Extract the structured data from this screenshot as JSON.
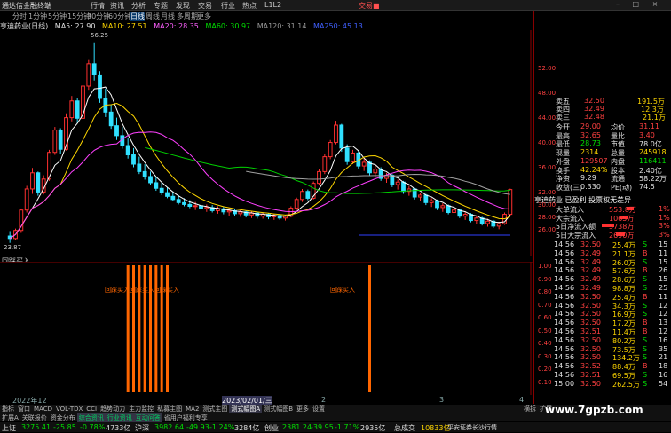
{
  "menu": {
    "logo": "通达信金融终端",
    "items": [
      "行情",
      "资讯",
      "分析",
      "专题",
      "发现",
      "交易",
      "行业",
      "热点",
      "L1L2"
    ],
    "trade": "交易■",
    "window_buttons": "– □ ×"
  },
  "periods": [
    "分时",
    "1分钟",
    "5分钟",
    "15分钟",
    "30分钟",
    "60分钟",
    "日线",
    "周线",
    "月线",
    "多周期",
    "更多"
  ],
  "active_period": "日线",
  "ma_line": {
    "stock": "亨迪药业(日线)",
    "ma5": "MA5: 27.90",
    "ma10": "MA10: 27.51",
    "ma20": "MA20: 28.35",
    "ma60": "MA60: 30.97",
    "ma120": "MA120: 31.14",
    "ma250": "MA250: 45.13"
  },
  "price_labels": {
    "high": "56.25",
    "low": "23.87"
  },
  "axis_ticks": [
    "52.00",
    "48.00",
    "44.00",
    "40.00",
    "36.00",
    "32.00",
    "30.00",
    "28.00",
    "26.00"
  ],
  "indicator": {
    "label": "回踩买入",
    "signal_texts": [
      "回踩买入回踩买入回踩买入",
      "回踩买入"
    ]
  },
  "sub_axis": [
    "1.00",
    "0.90",
    "0.80",
    "0.70",
    "0.60",
    "0.50",
    "0.40",
    "0.30",
    "0.20",
    "0.10"
  ],
  "dates": {
    "left": "2022年12",
    "mid": "2023/02/01/三",
    "m2": "2",
    "m3": "3",
    "m4": "4"
  },
  "tabs1": [
    "指标",
    "窗口",
    "MACD",
    "VOL-TDX",
    "CCI",
    "趋势动力",
    "主力监控",
    "私募主图",
    "MA2",
    "测式主图",
    "测式幅图A",
    "测式幅图B",
    "更多",
    "设置"
  ],
  "tabs1_selected": "测式幅图A",
  "tabs2": [
    "扩展A",
    "关联报价",
    "资金分布",
    "综合资讯",
    "行业资讯",
    "互动问答",
    "省用户福利专享"
  ],
  "tabs_right": [
    "横拆",
    "扩展"
  ],
  "quote": {
    "sell5": [
      "卖五",
      "32.50",
      "191.5万"
    ],
    "sell4": [
      "卖四",
      "32.49",
      "12.3万"
    ],
    "sell3": [
      "卖三",
      "32.48",
      "21.1万"
    ],
    "rows": [
      [
        "今开",
        "29.00",
        "均价",
        "31.11"
      ],
      [
        "最高",
        "32.65",
        "量比",
        "3.40"
      ],
      [
        "最低",
        "28.73",
        "市值",
        "78.0亿"
      ],
      [
        "现量",
        "2314",
        "总量",
        "245918"
      ],
      [
        "外盘",
        "129507",
        "内盘",
        "116411"
      ],
      [
        "换手",
        "42.24%",
        "股本",
        "2.40亿"
      ],
      [
        "净资",
        "9.29",
        "流通",
        "58.22万"
      ],
      [
        "收益(三)",
        "0.330",
        "PE(动)",
        "74.5"
      ]
    ],
    "company": "亨迪药业 已盈利 投票权无差异",
    "flows": [
      [
        "大单流入",
        "553.8万",
        "1%"
      ],
      [
        "大宗流入",
        "1065万",
        "1%"
      ],
      [
        "5日净流入额",
        "5738万",
        "3%"
      ],
      [
        "5日大宗流入",
        "2690万",
        "3%"
      ]
    ],
    "ticks": [
      [
        "14:56",
        "32.50",
        "25.4万",
        "S",
        "15"
      ],
      [
        "14:56",
        "32.49",
        "21.1万",
        "B",
        "11"
      ],
      [
        "14:56",
        "32.49",
        "26.0万",
        "S",
        "15"
      ],
      [
        "14:56",
        "32.49",
        "57.6万",
        "B",
        "26"
      ],
      [
        "14:56",
        "32.49",
        "28.6万",
        "S",
        "15"
      ],
      [
        "14:56",
        "32.49",
        "98.8万",
        "S",
        "25"
      ],
      [
        "14:56",
        "32.50",
        "25.4万",
        "B",
        "11"
      ],
      [
        "14:56",
        "32.50",
        "34.3万",
        "S",
        "12"
      ],
      [
        "14:56",
        "32.50",
        "16.9万",
        "S",
        "12"
      ],
      [
        "14:56",
        "32.50",
        "17.2万",
        "B",
        "13"
      ],
      [
        "14:56",
        "32.51",
        "11.4万",
        "B",
        "12"
      ],
      [
        "14:56",
        "32.50",
        "80.2万",
        "S",
        "16"
      ],
      [
        "14:56",
        "32.50",
        "73.5万",
        "S",
        "35"
      ],
      [
        "14:56",
        "32.50",
        "134.2万",
        "S",
        "21"
      ],
      [
        "14:56",
        "32.52",
        "88.4万",
        "B",
        "18"
      ],
      [
        "14:56",
        "32.51",
        "69.5万",
        "S",
        "16"
      ],
      [
        "15:00",
        "32.50",
        "262.5万",
        "S",
        "54"
      ]
    ]
  },
  "status": {
    "sh": [
      "上证",
      "3275.41",
      "-25.85",
      "-0.78%",
      "4733亿"
    ],
    "hs": [
      "沪深",
      "3982.64",
      "-49.93",
      "-1.24%",
      "3284亿"
    ],
    "cy": [
      "创业",
      "2381.24",
      "-39.95",
      "-1.71%",
      "2935亿"
    ],
    "misc": [
      "总成交",
      "10833亿",
      "平安证券长沙行情"
    ]
  },
  "watermark": "www.7gpzb.com",
  "colors": {
    "up": "#ff3030",
    "down": "#30e0ff",
    "ma5": "#ffffff",
    "ma10": "#ffd700",
    "ma20": "#ff40ff",
    "ma60": "#00d000",
    "ma120": "#a0a0a0",
    "signal": "#ff6600"
  },
  "chart_data": {
    "type": "candlestick",
    "y_range": [
      23,
      56.5
    ],
    "candles": [
      [
        25,
        25.8,
        23.9,
        24.6
      ],
      [
        24.6,
        26.2,
        24.3,
        25.9
      ],
      [
        25.9,
        29.4,
        25.5,
        29.2
      ],
      [
        29.2,
        33.1,
        28.8,
        32.6
      ],
      [
        32.6,
        36,
        31.8,
        35.2
      ],
      [
        35.2,
        35.4,
        31.5,
        32.1
      ],
      [
        32.1,
        34.8,
        31.7,
        34.2
      ],
      [
        34.2,
        38.9,
        33.9,
        38.5
      ],
      [
        38.5,
        42.6,
        38.1,
        42.1
      ],
      [
        42.1,
        42.4,
        38.2,
        39
      ],
      [
        39,
        44.8,
        38.8,
        44.1
      ],
      [
        44.1,
        47.6,
        43.5,
        46.8
      ],
      [
        46.8,
        47.2,
        43.2,
        44
      ],
      [
        44,
        49.8,
        43.6,
        49.2
      ],
      [
        49.2,
        53.4,
        48.6,
        52.8
      ],
      [
        52.8,
        56.25,
        50.1,
        51
      ],
      [
        51,
        51.6,
        46.5,
        47.2
      ],
      [
        47.2,
        48.8,
        44.2,
        45
      ],
      [
        45,
        46.2,
        42.3,
        42.8
      ],
      [
        42.8,
        44.1,
        40.5,
        41.2
      ],
      [
        41.2,
        42.6,
        39.1,
        39.6
      ],
      [
        39.6,
        40.9,
        37.5,
        38.1
      ],
      [
        38.1,
        39.2,
        36.1,
        36.6
      ],
      [
        36.6,
        37.8,
        35,
        35.4
      ],
      [
        35.4,
        36.6,
        34.1,
        34.6
      ],
      [
        34.6,
        35.4,
        33.2,
        33.6
      ],
      [
        33.6,
        34.5,
        32.3,
        32.7
      ],
      [
        32.7,
        33.6,
        31.6,
        32
      ],
      [
        32,
        32.9,
        31.1,
        31.4
      ],
      [
        31.4,
        32.2,
        30.6,
        30.9
      ],
      [
        30.9,
        31.6,
        30.1,
        30.4
      ],
      [
        30.4,
        31.1,
        29.8,
        30.1
      ],
      [
        30.1,
        30.8,
        29.5,
        29.8
      ],
      [
        29.8,
        30.5,
        29.2,
        29.9
      ],
      [
        29.9,
        30.3,
        29.1,
        29.4
      ],
      [
        29.4,
        30.1,
        28.9,
        29.6
      ],
      [
        29.6,
        30,
        28.8,
        29.1
      ],
      [
        29.1,
        29.8,
        28.6,
        29.4
      ],
      [
        29.4,
        29.7,
        28.5,
        28.9
      ],
      [
        28.9,
        29.5,
        28.3,
        29.1
      ],
      [
        29.1,
        29.4,
        28.2,
        28.6
      ],
      [
        28.6,
        29.2,
        28.1,
        28.9
      ],
      [
        28.9,
        29.1,
        28,
        28.4
      ],
      [
        28.4,
        29,
        27.9,
        28.7
      ],
      [
        28.7,
        28.9,
        27.8,
        28.2
      ],
      [
        28.2,
        28.8,
        27.8,
        28.5
      ],
      [
        28.5,
        28.7,
        27.7,
        28.1
      ],
      [
        28.1,
        28.6,
        27.6,
        28.3
      ],
      [
        28.3,
        28.5,
        27.6,
        27.9
      ],
      [
        27.9,
        28.4,
        27.5,
        28.2
      ],
      [
        28.2,
        29.8,
        28,
        29.5
      ],
      [
        29.5,
        31.2,
        29.2,
        30.9
      ],
      [
        30.9,
        32.6,
        30.5,
        32.2
      ],
      [
        32.2,
        32.5,
        30.8,
        31.1
      ],
      [
        31.1,
        33.8,
        30.9,
        33.5
      ],
      [
        33.5,
        35.8,
        33.2,
        35.4
      ],
      [
        35.4,
        38.2,
        35,
        37.8
      ],
      [
        37.8,
        40.5,
        37.4,
        40.1
      ],
      [
        40.1,
        43.6,
        39.8,
        42.9
      ],
      [
        42.9,
        43.1,
        38.6,
        39.2
      ],
      [
        39.2,
        39.8,
        36.5,
        37
      ],
      [
        37,
        38.9,
        36.6,
        38.4
      ],
      [
        38.4,
        38.7,
        35.9,
        36.3
      ],
      [
        36.3,
        37.5,
        35.5,
        36.9
      ],
      [
        36.9,
        37.2,
        34.8,
        35.2
      ],
      [
        35.2,
        36.3,
        34.6,
        35.8
      ],
      [
        35.8,
        36.1,
        33.9,
        34.3
      ],
      [
        34.3,
        35.2,
        33.6,
        34.8
      ],
      [
        34.8,
        35,
        32.9,
        33.3
      ],
      [
        33.3,
        34.1,
        32.5,
        33.7
      ],
      [
        33.7,
        33.9,
        31.8,
        32.2
      ],
      [
        32.2,
        33.1,
        31.5,
        32.6
      ],
      [
        32.6,
        32.8,
        30.9,
        31.3
      ],
      [
        31.3,
        32,
        30.6,
        31.6
      ],
      [
        31.6,
        31.8,
        30,
        30.4
      ],
      [
        30.4,
        31.1,
        29.7,
        30.7
      ],
      [
        30.7,
        30.9,
        29.2,
        29.6
      ],
      [
        29.6,
        30.3,
        28.9,
        29.9
      ],
      [
        29.9,
        30.1,
        28.5,
        28.8
      ],
      [
        28.8,
        29.6,
        28.2,
        29.2
      ],
      [
        29.2,
        29.4,
        27.9,
        28.2
      ],
      [
        28.2,
        28.9,
        27.6,
        28.5
      ],
      [
        28.5,
        28.7,
        27.2,
        27.5
      ],
      [
        27.5,
        28.3,
        27,
        27.9
      ],
      [
        27.9,
        28.1,
        26.7,
        27
      ],
      [
        27,
        27.8,
        26.5,
        27.4
      ],
      [
        27.4,
        27.6,
        26.3,
        26.6
      ],
      [
        26.6,
        27.3,
        26.1,
        27
      ],
      [
        27,
        28.8,
        26.8,
        28.5
      ],
      [
        28.5,
        32.65,
        28.3,
        32.5
      ]
    ],
    "signals_bars": [
      21,
      22,
      23,
      24,
      25,
      26,
      27,
      28,
      64
    ]
  }
}
